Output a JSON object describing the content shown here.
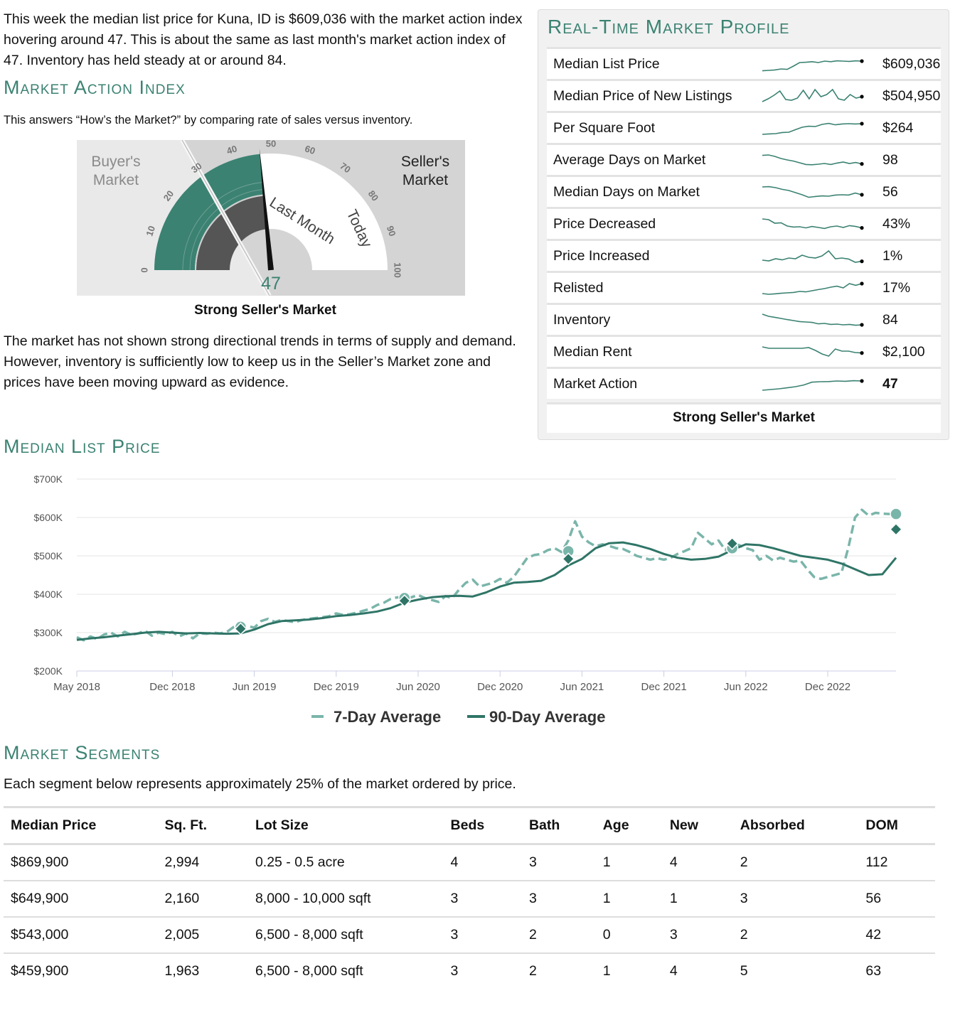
{
  "intro_text": "This week the median list price for Kuna, ID is $609,036 with the market action index hovering around 47. This is about the same as last month's market action index of 47. Inventory has held steady at or around 84.",
  "market_action_index": {
    "title": "Market Action Index",
    "subtitle": "This answers “How’s the Market?” by comparing rate of sales versus inventory.",
    "buyers_label_1": "Buyer's",
    "buyers_label_2": "Market",
    "sellers_label_1": "Seller's",
    "sellers_label_2": "Market",
    "last_month_label": "Last Month",
    "today_label": "Today",
    "value": "47",
    "value_num": 47,
    "last_month_value": 47,
    "ticks": [
      "0",
      "10",
      "20",
      "30",
      "40",
      "50",
      "60",
      "70",
      "80",
      "90",
      "100"
    ],
    "caption": "Strong Seller's Market",
    "colors": {
      "accent": "#3b8272",
      "dark": "#555555",
      "light": "#e9e9e9",
      "panel": "#d4d4d4"
    }
  },
  "market_text": "The market has not shown strong directional trends in terms of supply and demand. However, inventory is sufficiently low to keep us in the Seller’s Market zone and prices have been moving upward as evidence.",
  "profile": {
    "title": "Real-Time Market Profile",
    "rows": [
      {
        "label": "Median List Price",
        "value": "$609,036",
        "spark": [
          0.02,
          0.05,
          0.08,
          0.15,
          0.12,
          0.35,
          0.6,
          0.62,
          0.66,
          0.6,
          0.7,
          0.66,
          0.72,
          0.7,
          0.68,
          0.72,
          0.7
        ]
      },
      {
        "label": "Median Price of New Listings",
        "value": "$504,950",
        "spark": [
          0.1,
          0.3,
          0.55,
          0.85,
          0.25,
          0.2,
          0.35,
          0.9,
          0.3,
          0.95,
          0.45,
          0.6,
          0.95,
          0.3,
          0.2,
          0.6,
          0.35,
          0.45
        ]
      },
      {
        "label": "Per Square Foot",
        "value": "$264",
        "spark": [
          0.05,
          0.08,
          0.1,
          0.18,
          0.2,
          0.38,
          0.55,
          0.62,
          0.6,
          0.75,
          0.82,
          0.72,
          0.78,
          0.8,
          0.78,
          0.8
        ]
      },
      {
        "label": "Average Days on Market",
        "value": "98",
        "spark": [
          0.82,
          0.85,
          0.75,
          0.6,
          0.5,
          0.42,
          0.3,
          0.18,
          0.16,
          0.2,
          0.25,
          0.18,
          0.28,
          0.35,
          0.25,
          0.32,
          0.22
        ]
      },
      {
        "label": "Median Days on Market",
        "value": "56",
        "spark": [
          0.85,
          0.87,
          0.8,
          0.68,
          0.6,
          0.45,
          0.3,
          0.12,
          0.18,
          0.22,
          0.2,
          0.28,
          0.3,
          0.28,
          0.42,
          0.3
        ]
      },
      {
        "label": "Price Decreased",
        "value": "43%",
        "spark": [
          0.85,
          0.8,
          0.55,
          0.58,
          0.35,
          0.28,
          0.3,
          0.22,
          0.32,
          0.25,
          0.18,
          0.3,
          0.35,
          0.25,
          0.38,
          0.32,
          0.22
        ]
      },
      {
        "label": "Price Increased",
        "value": "1%",
        "spark": [
          0.2,
          0.15,
          0.3,
          0.22,
          0.35,
          0.3,
          0.55,
          0.4,
          0.35,
          0.5,
          0.85,
          0.3,
          0.35,
          0.28,
          0.05,
          0.12
        ]
      },
      {
        "label": "Relisted",
        "value": "17%",
        "spark": [
          0.1,
          0.05,
          0.08,
          0.12,
          0.15,
          0.18,
          0.25,
          0.22,
          0.3,
          0.38,
          0.45,
          0.55,
          0.62,
          0.5,
          0.8,
          0.68,
          0.8
        ]
      },
      {
        "label": "Inventory",
        "value": "84",
        "spark": [
          0.9,
          0.75,
          0.68,
          0.6,
          0.52,
          0.45,
          0.38,
          0.35,
          0.32,
          0.22,
          0.25,
          0.18,
          0.2,
          0.15,
          0.18,
          0.12,
          0.15
        ]
      },
      {
        "label": "Median Rent",
        "value": "$2,100",
        "spark": [
          0.85,
          0.75,
          0.75,
          0.75,
          0.75,
          0.75,
          0.75,
          0.8,
          0.6,
          0.35,
          0.2,
          0.7,
          0.55,
          0.55,
          0.45,
          0.42
        ]
      },
      {
        "label": "Market Action",
        "value": "47",
        "bold": true,
        "spark": [
          0.05,
          0.1,
          0.15,
          0.22,
          0.3,
          0.42,
          0.62,
          0.65,
          0.66,
          0.7,
          0.68,
          0.72,
          0.7
        ]
      }
    ],
    "footer": "Strong Seller's Market"
  },
  "median_list_price": {
    "title": "Median List Price"
  },
  "chart_data": {
    "type": "line",
    "title": "",
    "xlabel": "",
    "ylabel": "",
    "ylim": [
      200000,
      700000
    ],
    "y_ticks": [
      "$200K",
      "$300K",
      "$400K",
      "$500K",
      "$600K",
      "$700K"
    ],
    "y_tick_values": [
      200000,
      300000,
      400000,
      500000,
      600000,
      700000
    ],
    "x_ticks": [
      "May 2018",
      "Dec 2018",
      "Jun 2019",
      "Dec 2019",
      "Jun 2020",
      "Dec 2020",
      "Jun 2021",
      "Dec 2021",
      "Jun 2022",
      "Dec 2022"
    ],
    "x_tick_months": [
      0,
      7,
      13,
      19,
      25,
      31,
      37,
      43,
      49,
      55
    ],
    "x_range_months": [
      0,
      60
    ],
    "legend_position": "bottom",
    "series": [
      {
        "name": "7-Day Average",
        "style": "dashed",
        "color": "#7ab5aa",
        "x": [
          0,
          0.5,
          1,
          1.5,
          2,
          2.5,
          3,
          3.5,
          4,
          4.5,
          5,
          5.5,
          6,
          6.5,
          7,
          7.5,
          8,
          8.5,
          9,
          9.5,
          10,
          10.5,
          11,
          11.5,
          12,
          12.5,
          13,
          13.5,
          14,
          14.5,
          15,
          15.5,
          16,
          16.5,
          17,
          17.5,
          18,
          18.5,
          19,
          19.5,
          20,
          20.5,
          21,
          21.5,
          22,
          22.5,
          23,
          23.5,
          24,
          24.5,
          25,
          25.5,
          26,
          26.5,
          27,
          27.5,
          28,
          28.5,
          29,
          29.5,
          30,
          30.5,
          31,
          31.5,
          32,
          32.5,
          33,
          33.5,
          34,
          34.5,
          35,
          35.5,
          36,
          36.5,
          37,
          37.5,
          38,
          38.5,
          39,
          39.5,
          40,
          40.5,
          41,
          41.5,
          42,
          42.5,
          43,
          43.5,
          44,
          44.5,
          45,
          45.5,
          46,
          46.5,
          47,
          47.5,
          48,
          48.5,
          49,
          49.5,
          50,
          50.5,
          51,
          51.5,
          52,
          52.5,
          53,
          53.5,
          54,
          54.5,
          55,
          55.5,
          56,
          56.5,
          57,
          57.5,
          58,
          58.5,
          59,
          59.5,
          60
        ],
        "y": [
          288000,
          280000,
          290000,
          283000,
          295000,
          300000,
          290000,
          302000,
          294000,
          298000,
          305000,
          292000,
          300000,
          296000,
          302000,
          290000,
          298000,
          285000,
          298000,
          297000,
          300000,
          298000,
          302000,
          315000,
          322000,
          317000,
          313000,
          330000,
          336000,
          328000,
          333000,
          330000,
          327000,
          333000,
          336000,
          338000,
          340000,
          343000,
          350000,
          346000,
          348000,
          352000,
          357000,
          362000,
          372000,
          378000,
          388000,
          392000,
          385000,
          392000,
          398000,
          390000,
          385000,
          380000,
          395000,
          390000,
          412000,
          430000,
          438000,
          420000,
          425000,
          430000,
          440000,
          430000,
          445000,
          470000,
          495000,
          502000,
          505000,
          515000,
          520000,
          510000,
          540000,
          590000,
          550000,
          535000,
          525000,
          530000,
          526000,
          520000,
          518000,
          510000,
          500000,
          495000,
          490000,
          494000,
          490000,
          495000,
          505000,
          512000,
          520000,
          560000,
          545000,
          530000,
          540000,
          515000,
          535000,
          528000,
          520000,
          515000,
          490000,
          500000,
          488000,
          495000,
          490000,
          485000,
          488000,
          465000,
          445000,
          440000,
          445000,
          450000,
          455000,
          520000,
          600000,
          620000,
          605000,
          612000,
          610000,
          609000,
          609036
        ]
      },
      {
        "name": "90-Day Average",
        "style": "solid",
        "color": "#2f7567",
        "x": [
          0,
          1,
          2,
          3,
          4,
          5,
          6,
          7,
          8,
          9,
          10,
          11,
          12,
          13,
          14,
          15,
          16,
          17,
          18,
          19,
          20,
          21,
          22,
          23,
          24,
          25,
          26,
          27,
          28,
          29,
          30,
          31,
          32,
          33,
          34,
          35,
          36,
          37,
          38,
          39,
          40,
          41,
          42,
          43,
          44,
          45,
          46,
          47,
          48,
          49,
          50,
          51,
          52,
          53,
          54,
          55,
          56,
          57,
          58,
          59,
          60
        ],
        "y": [
          281000,
          285000,
          288000,
          292000,
          296000,
          300000,
          302000,
          300000,
          298000,
          299000,
          298000,
          297000,
          298000,
          308000,
          322000,
          330000,
          332000,
          334000,
          338000,
          343000,
          346000,
          350000,
          355000,
          364000,
          378000,
          386000,
          392000,
          395000,
          396000,
          394000,
          405000,
          420000,
          430000,
          432000,
          435000,
          450000,
          475000,
          492000,
          520000,
          533000,
          535000,
          528000,
          518000,
          505000,
          495000,
          490000,
          492000,
          498000,
          515000,
          530000,
          528000,
          520000,
          510000,
          500000,
          495000,
          490000,
          480000,
          465000,
          450000,
          452000,
          495000
        ]
      }
    ],
    "markers": [
      {
        "series": "7-Day Average",
        "x": 12,
        "y": 315000
      },
      {
        "series": "90-Day Average",
        "x": 12,
        "y": 310000
      },
      {
        "series": "7-Day Average",
        "x": 24,
        "y": 390000
      },
      {
        "series": "90-Day Average",
        "x": 24,
        "y": 383000
      },
      {
        "series": "7-Day Average",
        "x": 36,
        "y": 512000
      },
      {
        "series": "90-Day Average",
        "x": 36,
        "y": 492000
      },
      {
        "series": "7-Day Average",
        "x": 48,
        "y": 520000
      },
      {
        "series": "90-Day Average",
        "x": 48,
        "y": 532000
      },
      {
        "series": "7-Day Average",
        "x": 60,
        "y": 609036
      },
      {
        "series": "90-Day Average",
        "x": 60,
        "y": 569000
      }
    ]
  },
  "segments": {
    "title": "Market Segments",
    "subtitle": "Each segment below represents approximately 25% of the market ordered by price.",
    "headers": [
      "Median Price",
      "Sq. Ft.",
      "Lot Size",
      "Beds",
      "Bath",
      "Age",
      "New",
      "Absorbed",
      "DOM"
    ],
    "rows": [
      [
        "$869,900",
        "2,994",
        "0.25 - 0.5 acre",
        "4",
        "3",
        "1",
        "4",
        "2",
        "112"
      ],
      [
        "$649,900",
        "2,160",
        "8,000 - 10,000 sqft",
        "3",
        "3",
        "1",
        "1",
        "3",
        "56"
      ],
      [
        "$543,000",
        "2,005",
        "6,500 - 8,000 sqft",
        "3",
        "2",
        "0",
        "3",
        "2",
        "42"
      ],
      [
        "$459,900",
        "1,963",
        "6,500 - 8,000 sqft",
        "3",
        "2",
        "1",
        "4",
        "5",
        "63"
      ]
    ]
  }
}
